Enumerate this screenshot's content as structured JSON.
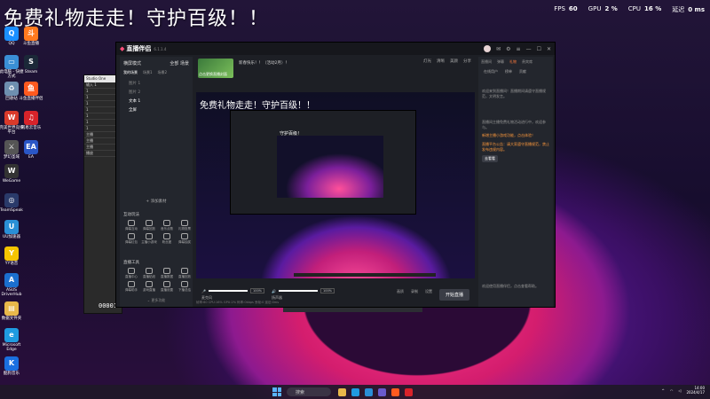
{
  "overlay": {
    "title": "免费礼物走走！守护百级！！"
  },
  "stats": [
    {
      "label": "FPS",
      "value": "60"
    },
    {
      "label": "GPU",
      "value": "2 %"
    },
    {
      "label": "CPU",
      "value": "16 %"
    },
    {
      "label": "延迟",
      "value": "0 ms"
    }
  ],
  "desktop_icons_left": [
    {
      "name": "QQ",
      "color": "#1b8fff",
      "glyph": "Q"
    },
    {
      "name": "此电脑 - 快捷方式",
      "color": "#3a8fd6",
      "glyph": "▭"
    },
    {
      "name": "回收站",
      "color": "#6e8fb0",
      "glyph": "♻"
    },
    {
      "name": "完美世界竞技平台",
      "color": "#d93a2b",
      "glyph": "W"
    },
    {
      "name": "梦幻圣域",
      "color": "#555555",
      "glyph": "⚔"
    },
    {
      "name": "WeGame",
      "color": "#333333",
      "glyph": "W"
    },
    {
      "name": "TeamSpeak",
      "color": "#2a3a6a",
      "glyph": "◎"
    },
    {
      "name": "UU加速器",
      "color": "#2a8fd6",
      "glyph": "U"
    },
    {
      "name": "YY语音",
      "color": "#f5c400",
      "glyph": "Y"
    },
    {
      "name": "ASUS DriverHub",
      "color": "#1b6fcf",
      "glyph": "A"
    },
    {
      "name": "数据文件夹",
      "color": "#e8b84a",
      "glyph": "▤"
    },
    {
      "name": "Microsoft Edge",
      "color": "#1f9be0",
      "glyph": "e"
    },
    {
      "name": "酷狗音乐",
      "color": "#1a6fe0",
      "glyph": "K"
    }
  ],
  "desktop_icons_right": [
    {
      "name": "斗鱼直播",
      "color": "#ff7a1f",
      "glyph": "斗"
    },
    {
      "name": "Steam",
      "color": "#1b2838",
      "glyph": "S"
    },
    {
      "name": "斗鱼直播伴侣",
      "color": "#ff5a1f",
      "glyph": "鱼"
    },
    {
      "name": "网易云音乐",
      "color": "#d8232a",
      "glyph": "♫"
    },
    {
      "name": "EA",
      "color": "#2a56c6",
      "glyph": "EA"
    }
  ],
  "daw": {
    "title": "Studio One",
    "rows": [
      "输入 1",
      "1",
      "1",
      "1",
      "1",
      "1",
      "1",
      "1",
      "主播",
      "主播",
      "主播",
      "播放"
    ],
    "counter": "00001"
  },
  "app": {
    "logo": "直播伴侣",
    "version": "6.1.1.4",
    "left": {
      "mode": "横屏模式",
      "tab_all": "全部",
      "tab_other": "场景",
      "tabs": [
        "我的场景",
        "场景1",
        "场景2"
      ],
      "scenes": [
        "图片 1",
        "图片 2",
        "文本 1",
        "全屏"
      ],
      "add_source": "添加素材",
      "section_interact": "互动玩法",
      "section_live": "直播工具",
      "interact_tools": [
        "弹幕互动",
        "弹幕回放",
        "音乐点歌",
        "礼物投票",
        "弹幕红包",
        "主播小游戏",
        "粉丝团",
        "弹幕抽奖"
      ],
      "live_tools": [
        "直播中心",
        "直播贴纸",
        "直播数据",
        "直播回放",
        "弹幕助手",
        "游戏直播",
        "直播设置",
        "下播总结"
      ],
      "more": "更多功能"
    },
    "center": {
      "banner": "新春快乐！！（活动2月）！",
      "thumb_label": "点击更换直播封面",
      "controls": [
        "灯光",
        "清晰",
        "美颜",
        "分享"
      ],
      "preview_title": "免费礼物走走！守护百级！！",
      "nested_title": "守护百级！",
      "mic_label": "麦克风",
      "mic_value": "100%",
      "speaker_label": "扬声器",
      "speaker_value": "100%",
      "tools": [
        "画质",
        "录制",
        "设置"
      ],
      "live_button": "开始直播",
      "status": "帧率:60  CPU:16%  GPU:2%  码率:0kbps  丢帧:0  延迟:0ms"
    },
    "right": {
      "tabs": [
        "直播间",
        "弹幕",
        "礼物",
        "贵宾席"
      ],
      "subtabs": [
        "在线用户",
        "榜单",
        "贡献"
      ],
      "messages": [
        {
          "text": "欢迎来到直播间！直播期间请遵守直播规范，文明发言。",
          "hl": false
        },
        {
          "text": "直播间主播免费礼物活动进行中，欢迎参与。",
          "hl": false
        },
        {
          "text": "新增主播小游戏功能，点击体验！",
          "hl": true
        },
        {
          "text": "直播平台公告：请大家遵守直播规范，禁止发布违规内容。",
          "hl": true
        }
      ],
      "msg_button": "去看看",
      "footer": "欢迎使用直播伴侣，点击查看帮助。"
    }
  },
  "taskbar": {
    "search": "搜索",
    "time": "14:00",
    "date": "2024/4/17"
  }
}
